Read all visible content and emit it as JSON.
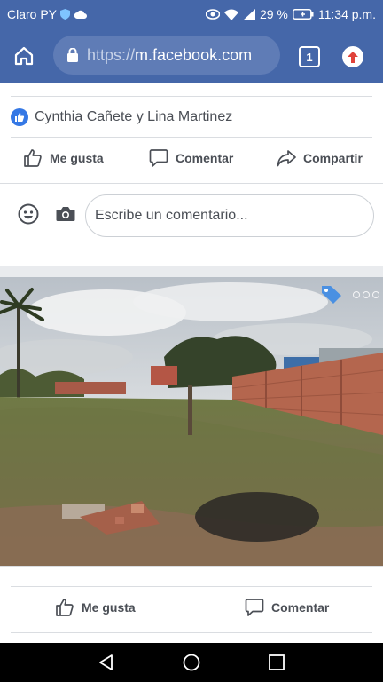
{
  "status_bar": {
    "carrier": "Claro PY",
    "battery": "29 %",
    "time": "11:34 p.m."
  },
  "browser": {
    "url_scheme": "https://",
    "url_host": "m.facebook.com",
    "tab_count": "1"
  },
  "post": {
    "reactors": "Cynthia Cañete y Lina Martinez",
    "actions": {
      "like": "Me gusta",
      "comment": "Comentar",
      "share": "Compartir"
    },
    "comment_placeholder": "Escribe un comentario..."
  },
  "next_post": {
    "actions": {
      "like": "Me gusta",
      "comment": "Comentar"
    }
  },
  "colors": {
    "brand_blue": "#4567a9",
    "url_pill": "#5f7cb6",
    "like_badge": "#3578e5",
    "update_icon": "#e0423a"
  },
  "icons": [
    "home-icon",
    "lock-icon",
    "tabs-icon",
    "update-icon",
    "like-badge-icon",
    "thumbs-up-icon",
    "comment-icon",
    "share-icon",
    "emoji-icon",
    "camera-icon",
    "tag-icon",
    "more-icon",
    "back-icon",
    "home-nav-icon",
    "recents-icon"
  ]
}
